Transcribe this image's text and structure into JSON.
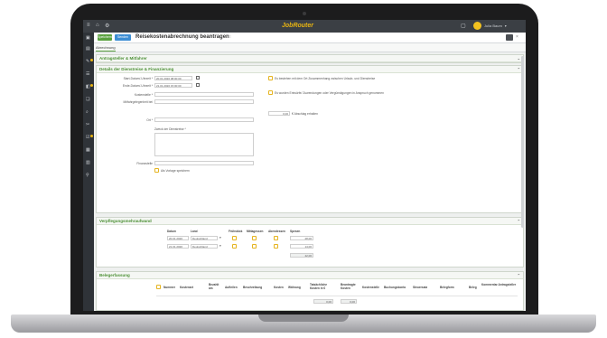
{
  "app": {
    "brand": "JobRouter",
    "window_title": "Reisekostenabrechnung beantragen",
    "user_name": "Julia Baum"
  },
  "toolbar": {
    "save_label": "Speichern",
    "send_label": "Senden"
  },
  "tabs": [
    {
      "label": "Abrechnung"
    }
  ],
  "sections": {
    "applicant": {
      "title": "Antragsteller & Mitfahrer"
    },
    "details": {
      "title": "Details der Dienstreise & Finanzierung",
      "start_label": "Start-Datum/-Uhrzeit *",
      "start_value": "20.01.2020 08:00:00",
      "end_label": "Ende-Datum/-Uhrzeit *",
      "end_value": "21.01.2020 15:00:00",
      "kostenstelle_label": "Kostenstelle *",
      "mitfahrgelegenheit_label": "Mitfahrgelegenheit bei",
      "ort_label": "Ort *",
      "zweck_label": "Zweck der Dienstreise *",
      "finanzstelle_label": "Finanzstelle",
      "save_label": "Als Vorlage speichern",
      "option1": "Es bestehen mit dem Ort Zusammenhang zwischen Urlaub- und Dienstreise",
      "option2": "Es wurden Entwürfe/ Zuwendungen oder Vergünstigungen in Anspruch genommen",
      "amount_value": "0,00",
      "amount_unit": "€ Abschlag erhalten"
    },
    "meals": {
      "title": "Verpflegungsmehraufwand",
      "headers": [
        "Datum",
        "Land",
        "Frühstück",
        "Mittagessen",
        "Abendessen",
        "Spesen"
      ],
      "rows": [
        {
          "date": "20.01.2020",
          "country": "Deutschland",
          "amount": "28,00"
        },
        {
          "date": "21.01.2020",
          "country": "Deutschland",
          "amount": "14,00"
        }
      ],
      "total": "42,00"
    },
    "receipts": {
      "title": "Belegerfassung",
      "headers": [
        "Nummer",
        "Kostenart",
        "Bezahlt am",
        "Aufteilen",
        "Beschreibung",
        "Kosten",
        "Währung",
        "Tatsächliche Kosten in €",
        "Beantragte Kosten",
        "Kostenstelle",
        "Buchungskonto",
        "Steuersatz",
        "Belegform",
        "Beleg",
        "Kommentar Antragsteller"
      ],
      "sum1": "0,00",
      "sum2": "0,00"
    }
  },
  "colors": {
    "accent": "#5aa13f",
    "brand": "#e8b411",
    "topbar": "#3b3f44"
  }
}
